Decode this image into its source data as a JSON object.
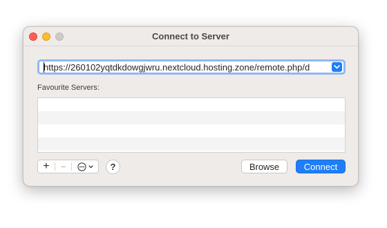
{
  "window": {
    "title": "Connect to Server"
  },
  "url_field": {
    "value": "https://260102yqtdkdowgjwru.nextcloud.hosting.zone/remote.php/d",
    "dropdown_icon": "chevron-down-icon"
  },
  "favourites": {
    "label": "Favourite Servers:",
    "items": []
  },
  "toolbar": {
    "add_label": "+",
    "remove_label": "−",
    "more_icon": "ellipsis-circle-icon",
    "help_label": "?"
  },
  "buttons": {
    "browse_label": "Browse",
    "connect_label": "Connect"
  },
  "colors": {
    "accent": "#1f7ef7",
    "close": "#fe5f57",
    "minimize": "#febc2e",
    "zoom_disabled": "#cfcac7"
  }
}
